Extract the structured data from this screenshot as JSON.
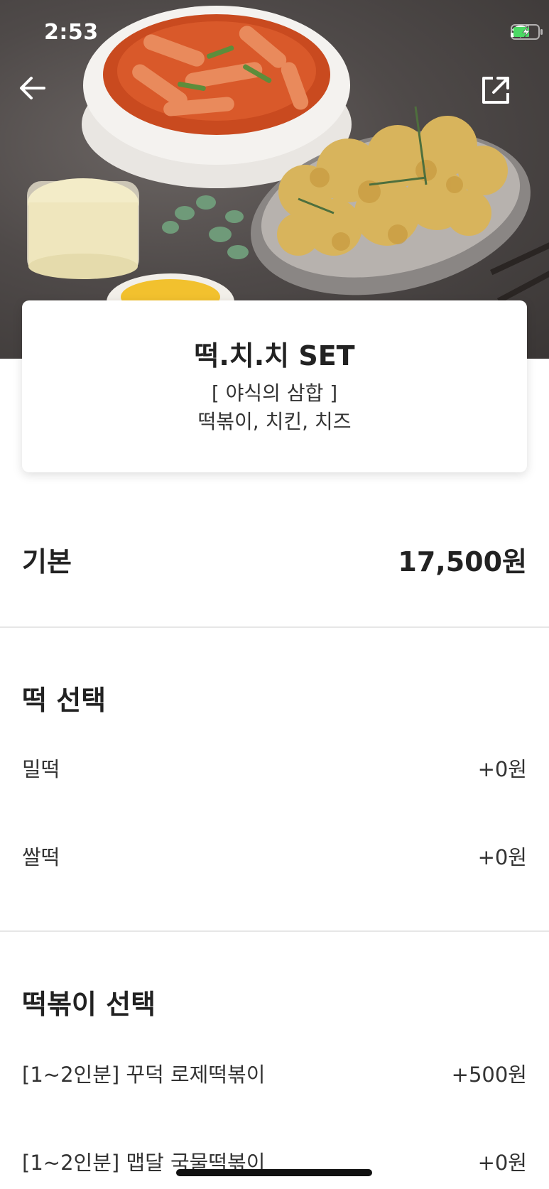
{
  "status_bar": {
    "time": "2:53"
  },
  "product": {
    "name": "떡.치.치 SET",
    "desc_line1": "[ 야식의 삼합 ]",
    "desc_line2": "떡볶이, 치킨, 치즈"
  },
  "base": {
    "label": "기본",
    "price": "17,500원"
  },
  "sections": [
    {
      "title": "떡 선택",
      "options": [
        {
          "label": "밀떡",
          "price": "+0원"
        },
        {
          "label": "쌀떡",
          "price": "+0원"
        }
      ]
    },
    {
      "title": "떡볶이 선택",
      "options": [
        {
          "label": "[1~2인분] 꾸덕 로제떡볶이",
          "price": "+500원"
        },
        {
          "label": "[1~2인분] 맵달 국물떡볶이",
          "price": "+0원"
        }
      ]
    }
  ],
  "icons": {
    "back": "arrow-left-icon",
    "share": "share-icon",
    "signal": "cellular-signal-icon",
    "wifi": "wifi-icon",
    "battery": "battery-charging-icon"
  },
  "colors": {
    "battery_fill": "#4cd964"
  }
}
